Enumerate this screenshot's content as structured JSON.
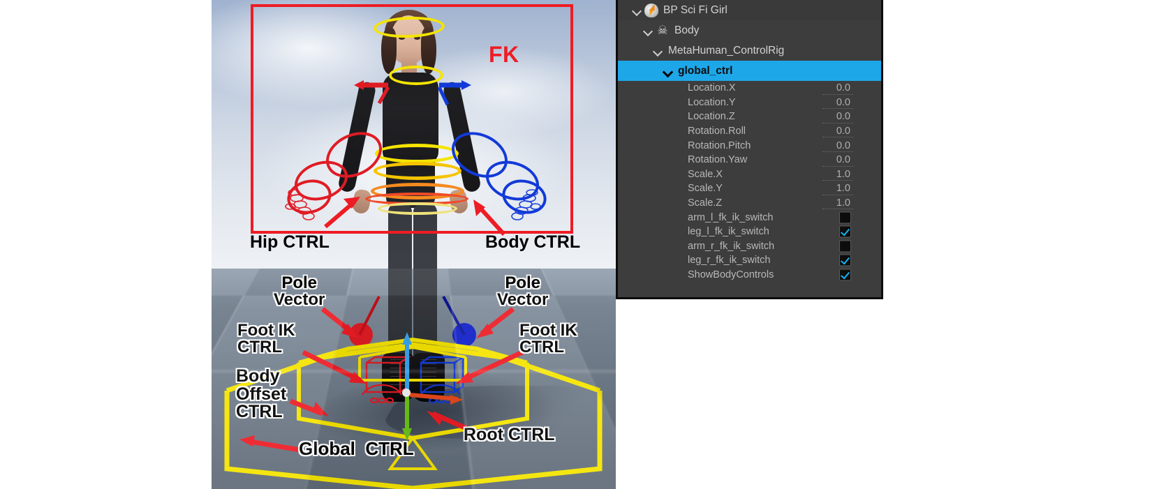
{
  "viewport": {
    "name": "unreal-level-viewport",
    "fk_label": "FK",
    "annotations": [
      {
        "id": "hip-ctrl",
        "text": "Hip CTRL"
      },
      {
        "id": "body-ctrl",
        "text": "Body CTRL"
      },
      {
        "id": "pole-vector-left",
        "text": "Pole\nVector"
      },
      {
        "id": "pole-vector-right",
        "text": "Pole\nVector"
      },
      {
        "id": "foot-ik-ctrl-left",
        "text": "Foot IK\nCTRL"
      },
      {
        "id": "foot-ik-ctrl-right",
        "text": "Foot IK\nCTRL"
      },
      {
        "id": "body-offset-ctrl",
        "text": "Body\nOffset\nCTRL"
      },
      {
        "id": "root-ctrl",
        "text": "Root CTRL"
      },
      {
        "id": "global-ctrl",
        "text": "Global  CTRL"
      }
    ],
    "colors": {
      "fk_box": "#ee1c24",
      "arrow": "#ee1c24",
      "global_ctrl_shape": "#f5e400",
      "pole_left": "#e01b24",
      "pole_right": "#0f1ec8"
    }
  },
  "outliner": {
    "name": "animation-outliner",
    "selected_row": "global_ctrl",
    "selection_color": "#1ea7e8",
    "tree": [
      {
        "label": "BP Sci Fi Girl",
        "icon": "blueprint-icon",
        "depth": 0,
        "expanded": true
      },
      {
        "label": "Body",
        "icon": "skeleton-icon",
        "depth": 1,
        "expanded": true
      },
      {
        "label": "MetaHuman_ControlRig",
        "icon": "none",
        "depth": 2,
        "expanded": true
      },
      {
        "label": "global_ctrl",
        "icon": "none",
        "depth": 3,
        "expanded": true,
        "selected": true
      }
    ],
    "properties": [
      {
        "label": "Location.X",
        "type": "number",
        "value": "0.0"
      },
      {
        "label": "Location.Y",
        "type": "number",
        "value": "0.0"
      },
      {
        "label": "Location.Z",
        "type": "number",
        "value": "0.0"
      },
      {
        "label": "Rotation.Roll",
        "type": "number",
        "value": "0.0"
      },
      {
        "label": "Rotation.Pitch",
        "type": "number",
        "value": "0.0"
      },
      {
        "label": "Rotation.Yaw",
        "type": "number",
        "value": "0.0"
      },
      {
        "label": "Scale.X",
        "type": "number",
        "value": "1.0"
      },
      {
        "label": "Scale.Y",
        "type": "number",
        "value": "1.0"
      },
      {
        "label": "Scale.Z",
        "type": "number",
        "value": "1.0"
      },
      {
        "label": "arm_l_fk_ik_switch",
        "type": "checkbox",
        "checked": false,
        "annotated": true
      },
      {
        "label": "leg_l_fk_ik_switch",
        "type": "checkbox",
        "checked": true,
        "annotated": true
      },
      {
        "label": "arm_r_fk_ik_switch",
        "type": "checkbox",
        "checked": false,
        "annotated": true
      },
      {
        "label": "leg_r_fk_ik_switch",
        "type": "checkbox",
        "checked": true,
        "annotated": true
      },
      {
        "label": "ShowBodyControls",
        "type": "checkbox",
        "checked": true,
        "annotated": true
      }
    ]
  }
}
